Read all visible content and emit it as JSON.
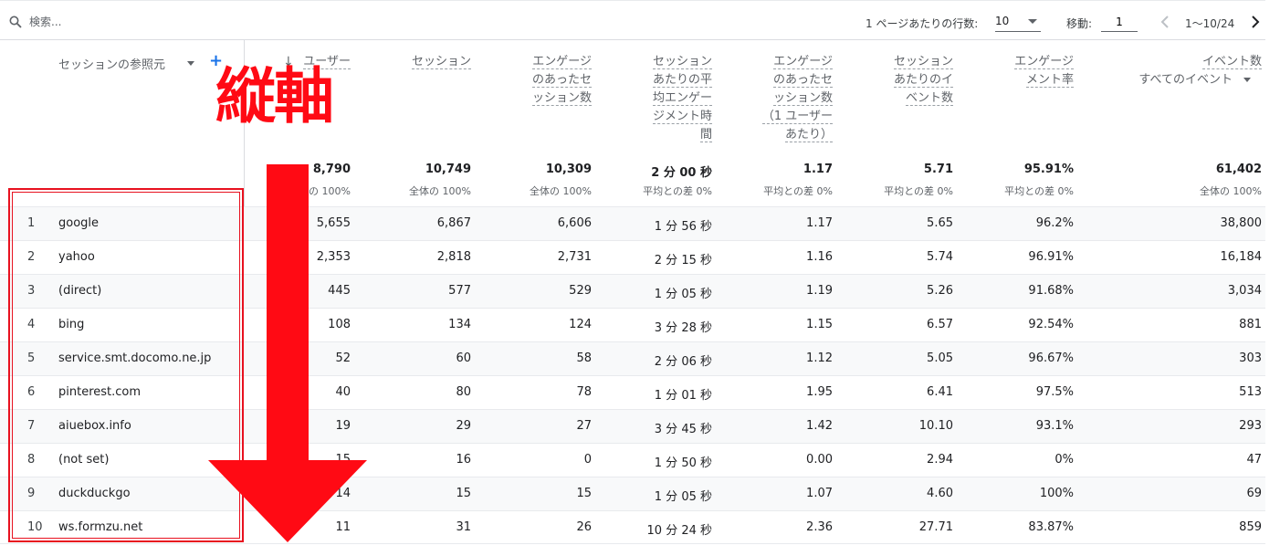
{
  "toolbar": {
    "search_placeholder": "検索...",
    "rows_per_page_label": "1 ページあたりの行数:",
    "rows_per_page_value": "10",
    "goto_label": "移動:",
    "goto_value": "1",
    "range_text": "1〜10/24"
  },
  "dimension_header": "セッションの参照元",
  "add_dimension": "+",
  "sort_arrow": "↓",
  "metrics": [
    {
      "key": "users",
      "header": [
        "ユーザー"
      ],
      "total": "8,790",
      "sub": "全体の 100%"
    },
    {
      "key": "sessions",
      "header": [
        "セッション"
      ],
      "total": "10,749",
      "sub": "全体の 100%"
    },
    {
      "key": "engaged_sessions",
      "header": [
        "エンゲージ",
        "のあったセ",
        "ッション数"
      ],
      "total": "10,309",
      "sub": "全体の 100%"
    },
    {
      "key": "avg_engagement",
      "header": [
        "セッション",
        "あたりの平",
        "均エンゲー",
        "ジメント時",
        "間"
      ],
      "total": "2 分 00 秒",
      "sub": "平均との差 0%"
    },
    {
      "key": "engaged_per_user",
      "header": [
        "エンゲージ",
        "のあったセ",
        "ッション数",
        "（1 ユーザー",
        "あたり）"
      ],
      "total": "1.17",
      "sub": "平均との差 0%"
    },
    {
      "key": "events_per_session",
      "header": [
        "セッション",
        "あたりのイ",
        "ベント数"
      ],
      "total": "5.71",
      "sub": "平均との差 0%"
    },
    {
      "key": "engagement_rate",
      "header": [
        "エンゲージ",
        "メント率"
      ],
      "total": "95.91%",
      "sub": "平均との差 0%"
    },
    {
      "key": "event_count",
      "header": [
        "イベント数",
        "すべてのイベント"
      ],
      "total": "61,402",
      "sub": "全体の 100%"
    }
  ],
  "rows": [
    {
      "idx": "1",
      "source": "google",
      "v": [
        "5,655",
        "6,867",
        "6,606",
        "1 分 56 秒",
        "1.17",
        "5.65",
        "96.2%",
        "38,800"
      ]
    },
    {
      "idx": "2",
      "source": "yahoo",
      "v": [
        "2,353",
        "2,818",
        "2,731",
        "2 分 15 秒",
        "1.16",
        "5.74",
        "96.91%",
        "16,184"
      ]
    },
    {
      "idx": "3",
      "source": "(direct)",
      "v": [
        "445",
        "577",
        "529",
        "1 分 05 秒",
        "1.19",
        "5.26",
        "91.68%",
        "3,034"
      ]
    },
    {
      "idx": "4",
      "source": "bing",
      "v": [
        "108",
        "134",
        "124",
        "3 分 28 秒",
        "1.15",
        "6.57",
        "92.54%",
        "881"
      ]
    },
    {
      "idx": "5",
      "source": "service.smt.docomo.ne.jp",
      "v": [
        "52",
        "60",
        "58",
        "2 分 06 秒",
        "1.12",
        "5.05",
        "96.67%",
        "303"
      ]
    },
    {
      "idx": "6",
      "source": "pinterest.com",
      "v": [
        "40",
        "80",
        "78",
        "1 分 01 秒",
        "1.95",
        "6.41",
        "97.5%",
        "513"
      ]
    },
    {
      "idx": "7",
      "source": "aiuebox.info",
      "v": [
        "19",
        "29",
        "27",
        "3 分 45 秒",
        "1.42",
        "10.10",
        "93.1%",
        "293"
      ]
    },
    {
      "idx": "8",
      "source": "(not set)",
      "v": [
        "15",
        "16",
        "0",
        "1 分 50 秒",
        "0.00",
        "2.94",
        "0%",
        "47"
      ]
    },
    {
      "idx": "9",
      "source": "duckduckgo",
      "v": [
        "14",
        "15",
        "15",
        "1 分 05 秒",
        "1.07",
        "4.60",
        "100%",
        "69"
      ]
    },
    {
      "idx": "10",
      "source": "ws.formzu.net",
      "v": [
        "11",
        "31",
        "26",
        "10 分 24 秒",
        "2.36",
        "27.71",
        "83.87%",
        "859"
      ]
    }
  ],
  "annotation": {
    "title": "縦軸",
    "color": "#ff0a14"
  }
}
